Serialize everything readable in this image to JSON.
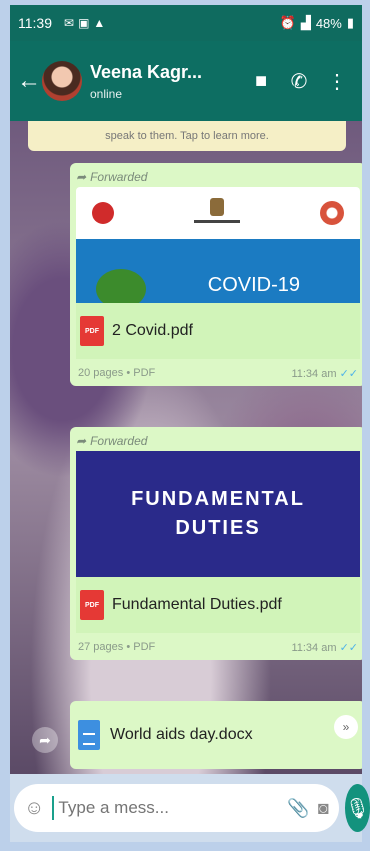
{
  "status_bar": {
    "time": "11:39",
    "icons": [
      "message-icon",
      "gallery-icon",
      "warning-icon"
    ],
    "battery": "48%"
  },
  "header": {
    "contact_name": "Veena Kagr...",
    "status": "online"
  },
  "info_banner": "speak to them. Tap to learn more.",
  "messages": [
    {
      "forwarded_label": "Forwarded",
      "preview_text": "COVID-19",
      "file_name": "2 Covid.pdf",
      "file_type": "PDF",
      "meta": "20 pages • PDF",
      "time": "11:34 am"
    },
    {
      "forwarded_label": "Forwarded",
      "preview_line1": "FUNDAMENTAL",
      "preview_line2": "DUTIES",
      "file_name": "Fundamental Duties.pdf",
      "file_type": "PDF",
      "meta": "27 pages • PDF",
      "time": "11:34 am"
    },
    {
      "file_name": "World aids day.docx"
    }
  ],
  "input": {
    "placeholder": "Type a mess..."
  },
  "colors": {
    "header": "#0d6e62",
    "bubble": "#dcf8c6",
    "mic": "#13927d",
    "ticks": "#4fb3e8"
  }
}
